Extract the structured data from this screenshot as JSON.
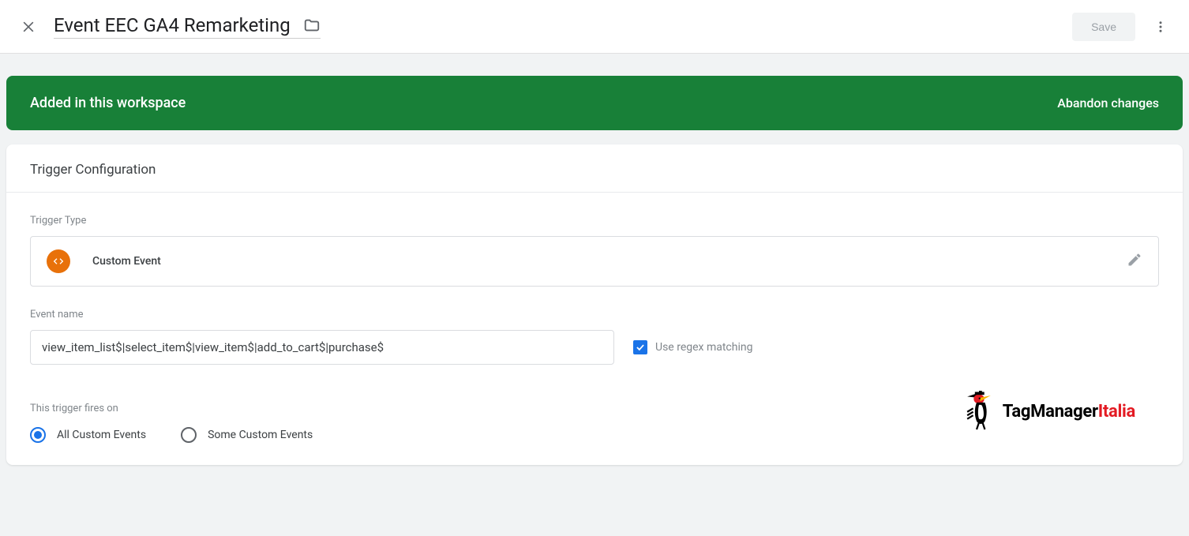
{
  "header": {
    "title": "Event EEC GA4 Remarketing",
    "save_label": "Save"
  },
  "banner": {
    "status": "Added in this workspace",
    "abandon": "Abandon changes"
  },
  "card": {
    "title": "Trigger Configuration",
    "trigger_type_label": "Trigger Type",
    "trigger_type_name": "Custom Event",
    "event_name_label": "Event name",
    "event_name_value": "view_item_list$|select_item$|view_item$|add_to_cart$|purchase$",
    "use_regex_label": "Use regex matching",
    "use_regex_checked": true,
    "fires_on_label": "This trigger fires on",
    "radio_all": "All Custom Events",
    "radio_some": "Some Custom Events",
    "radio_selected": "all"
  },
  "watermark": {
    "brand": "TagManager",
    "suffix": "Italia"
  }
}
